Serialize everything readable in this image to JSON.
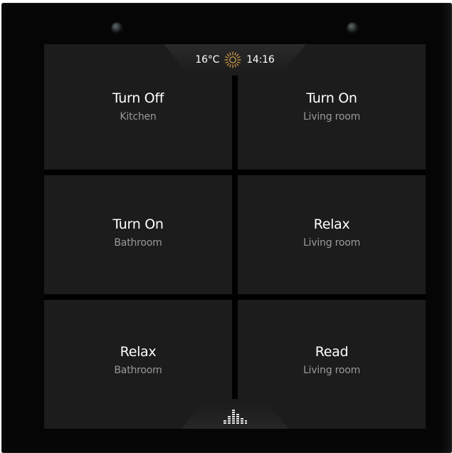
{
  "status": {
    "temperature": "16°C",
    "weather_icon": "sun-icon",
    "time": "14:16"
  },
  "tiles": [
    {
      "title": "Turn Off",
      "room": "Kitchen"
    },
    {
      "title": "Turn On",
      "room": "Living room"
    },
    {
      "title": "Turn On",
      "room": "Bathroom"
    },
    {
      "title": "Relax",
      "room": "Living room"
    },
    {
      "title": "Relax",
      "room": "Bathroom"
    },
    {
      "title": "Read",
      "room": "Living room"
    }
  ],
  "bottom_button": {
    "icon": "equalizer-icon"
  },
  "colors": {
    "weather_icon": "#d8a24a",
    "tile_bg": "#1c1c1c",
    "title_text": "#ffffff",
    "subtitle_text": "#9a9a9a"
  }
}
